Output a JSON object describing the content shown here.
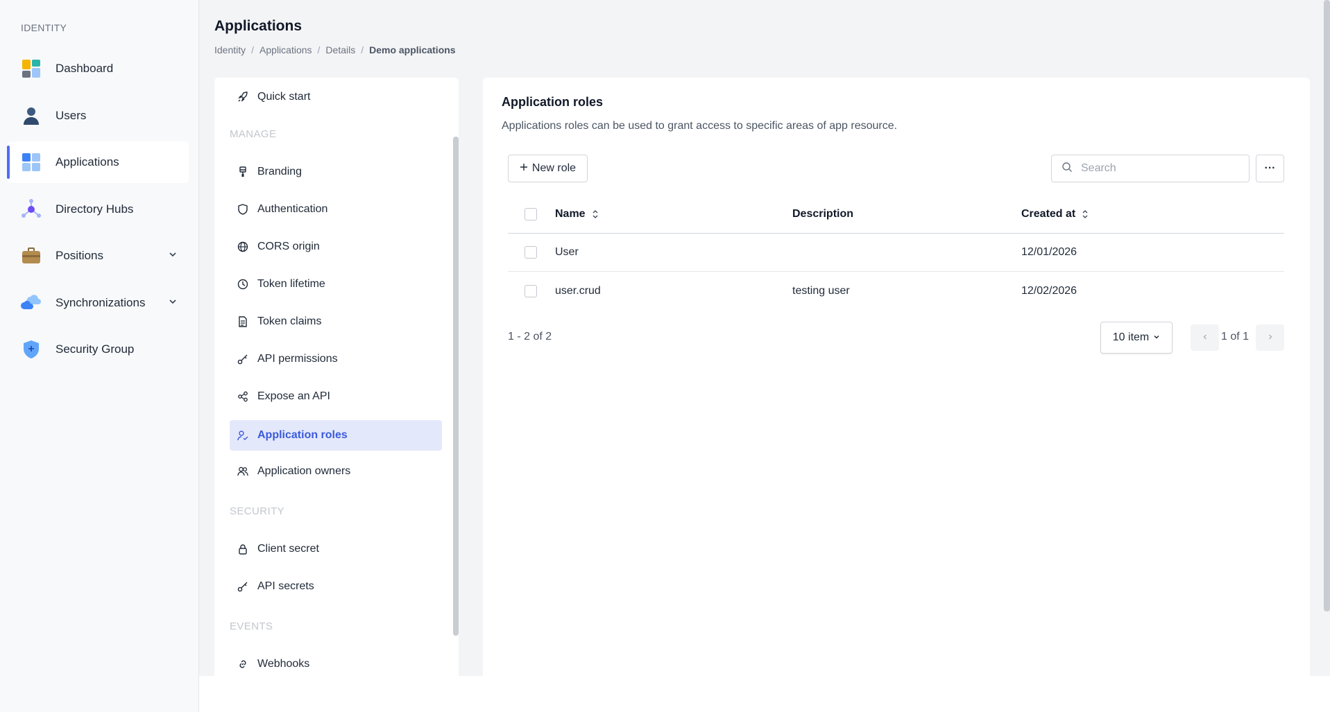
{
  "sidenav": {
    "section": "IDENTITY",
    "items": [
      {
        "label": "Dashboard",
        "icon": "dashboard-icon"
      },
      {
        "label": "Users",
        "icon": "user-icon"
      },
      {
        "label": "Applications",
        "icon": "applications-icon",
        "active": true
      },
      {
        "label": "Directory Hubs",
        "icon": "hub-icon"
      },
      {
        "label": "Positions",
        "icon": "briefcase-icon",
        "expandable": true
      },
      {
        "label": "Synchronizations",
        "icon": "cloud-sync-icon",
        "expandable": true
      },
      {
        "label": "Security Group",
        "icon": "shield-icon"
      }
    ]
  },
  "header": {
    "title": "Applications",
    "breadcrumb": [
      "Identity",
      "Applications",
      "Details",
      "Demo applications"
    ]
  },
  "submenu": {
    "quick_start": "Quick start",
    "manage_heading": "MANAGE",
    "manage": [
      "Branding",
      "Authentication",
      "CORS origin",
      "Token lifetime",
      "Token claims",
      "API permissions",
      "Expose an API",
      "Application roles",
      "Application owners"
    ],
    "security_heading": "SECURITY",
    "security": [
      "Client secret",
      "API secrets"
    ],
    "events_heading": "EVENTS",
    "events": [
      "Webhooks"
    ]
  },
  "content": {
    "title": "Application roles",
    "description": "Applications roles can be used to grant access to specific areas of app resource.",
    "new_role_label": "New role",
    "search_placeholder": "Search",
    "more_label": "···",
    "columns": [
      "Name",
      "Description",
      "Created at"
    ],
    "rows": [
      {
        "name": "User",
        "description": "",
        "created_at": "12/01/2026"
      },
      {
        "name": "user.crud",
        "description": "testing user",
        "created_at": "12/02/2026"
      }
    ],
    "pager": {
      "count": "1 - 2 of 2",
      "page_size": "10 item",
      "page": "1 of 1"
    }
  },
  "colors": {
    "accent": "#4f6df5",
    "active_bg": "#e4e8fb",
    "active_text": "#3b5bdb"
  }
}
